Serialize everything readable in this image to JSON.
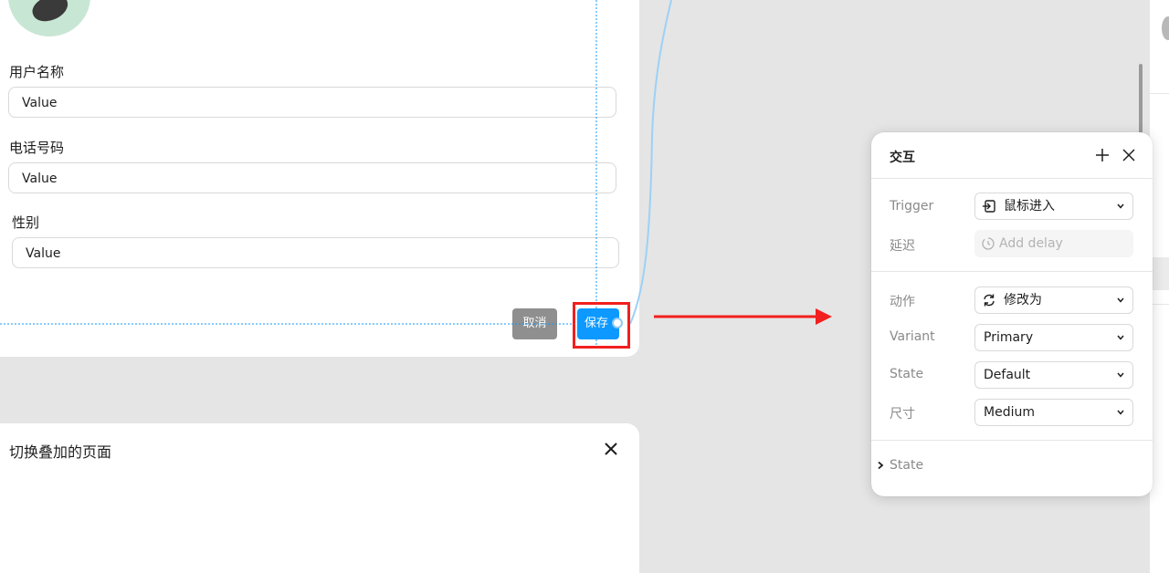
{
  "form": {
    "username_label": "用户名称",
    "username_value": "Value",
    "phone_label": "电话号码",
    "phone_value": "Value",
    "gender_label": "性别",
    "gender_value": "Value",
    "cancel_label": "取消",
    "save_label": "保存"
  },
  "overlay": {
    "title": "切换叠加的页面",
    "close_icon": "close-icon"
  },
  "interaction_panel": {
    "title": "交互",
    "add_icon": "plus-icon",
    "close_icon": "close-icon",
    "trigger_label": "Trigger",
    "trigger_value": "鼠标进入",
    "trigger_icon": "mouse-enter-icon",
    "delay_label": "延迟",
    "delay_placeholder": "Add delay",
    "delay_icon": "timer-icon",
    "action_label": "动作",
    "action_value": "修改为",
    "action_icon": "change-icon",
    "variant_label": "Variant",
    "variant_value": "Primary",
    "state_label": "State",
    "state_value": "Default",
    "size_label": "尺寸",
    "size_value": "Medium",
    "state_section": "State"
  },
  "colors": {
    "accent": "#0d99ff",
    "highlight_outline": "#f21f1f",
    "arrow": "#f21f1f",
    "cancel_bg": "#8f8f8f",
    "canvas_bg": "#e5e5e5"
  }
}
